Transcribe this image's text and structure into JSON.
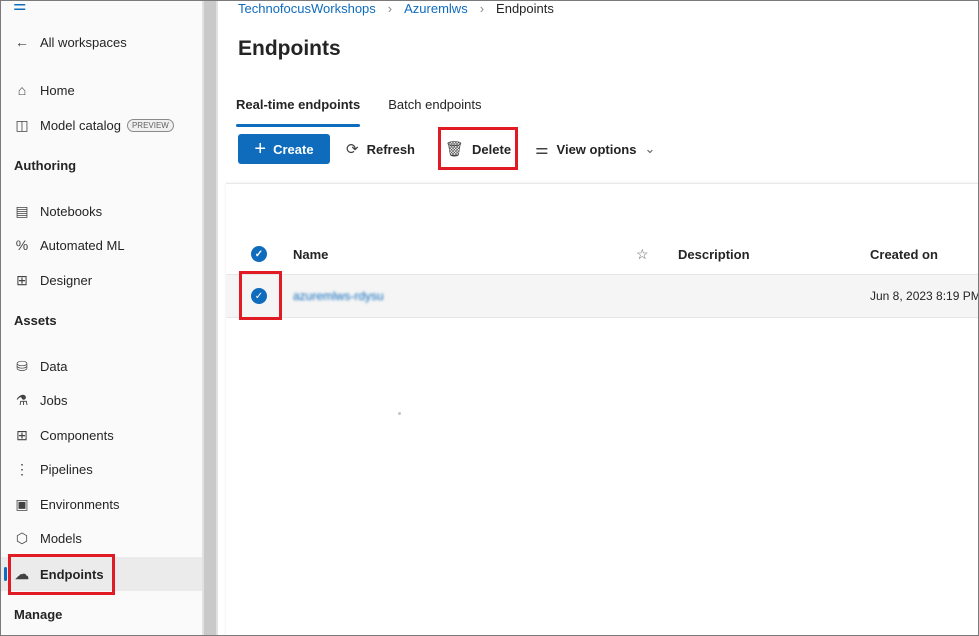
{
  "sidebar": {
    "back_label": "All workspaces",
    "home_label": "Home",
    "model_catalog_label": "Model catalog",
    "preview_badge": "PREVIEW",
    "authoring_title": "Authoring",
    "notebooks_label": "Notebooks",
    "automl_label": "Automated ML",
    "designer_label": "Designer",
    "assets_title": "Assets",
    "data_label": "Data",
    "jobs_label": "Jobs",
    "components_label": "Components",
    "pipelines_label": "Pipelines",
    "environments_label": "Environments",
    "models_label": "Models",
    "endpoints_label": "Endpoints",
    "manage_title": "Manage"
  },
  "breadcrumb": {
    "workspace_group": "TechnofocusWorkshops",
    "workspace": "Azuremlws",
    "current": "Endpoints"
  },
  "page": {
    "title": "Endpoints"
  },
  "tabs": {
    "realtime": "Real-time endpoints",
    "batch": "Batch endpoints"
  },
  "toolbar": {
    "create": "Create",
    "refresh": "Refresh",
    "delete": "Delete",
    "view_options": "View options"
  },
  "table": {
    "columns": {
      "name": "Name",
      "description": "Description",
      "created_on": "Created on"
    },
    "rows": [
      {
        "name": "azuremlws-rdysu",
        "description": "",
        "created_on": "Jun 8, 2023 8:19 PM"
      }
    ]
  },
  "colors": {
    "accent": "#0f6cbd",
    "highlight": "#e01b24"
  }
}
